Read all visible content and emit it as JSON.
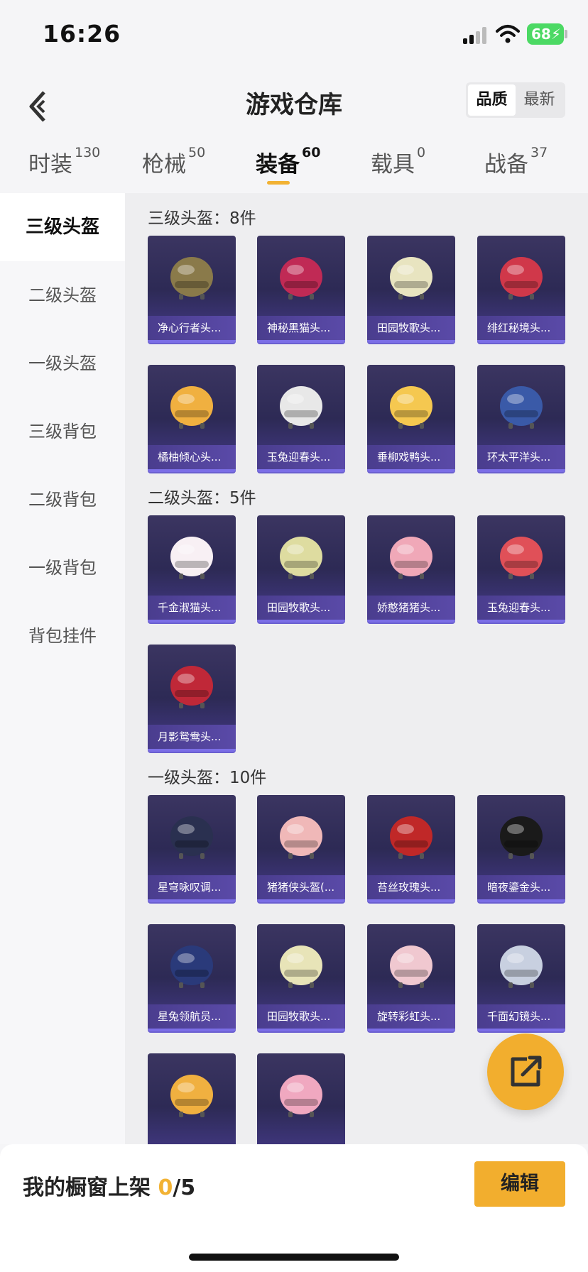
{
  "status_bar": {
    "time": "16:26",
    "battery": "68"
  },
  "nav": {
    "title": "游戏仓库",
    "sort_options": [
      "品质",
      "最新"
    ],
    "sort_selected": "品质"
  },
  "tabs": [
    {
      "label": "时装",
      "count": "130"
    },
    {
      "label": "枪械",
      "count": "50"
    },
    {
      "label": "装备",
      "count": "60"
    },
    {
      "label": "载具",
      "count": "0"
    },
    {
      "label": "战备",
      "count": "37"
    }
  ],
  "active_tab": "装备",
  "sidebar": {
    "items": [
      "三级头盔",
      "二级头盔",
      "一级头盔",
      "三级背包",
      "二级背包",
      "一级背包",
      "背包挂件"
    ],
    "active": "三级头盔"
  },
  "sections": [
    {
      "title": "三级头盔：8件",
      "items": [
        "净心行者头...",
        "神秘黑猫头...",
        "田园牧歌头...",
        "绯红秘境头...",
        "橘柚倾心头...",
        "玉兔迎春头...",
        "垂柳戏鸭头...",
        "环太平洋头..."
      ]
    },
    {
      "title": "二级头盔：5件",
      "items": [
        "千金淑猫头...",
        "田园牧歌头...",
        "娇憨猪猪头...",
        "玉兔迎春头...",
        "月影鸳鸯头..."
      ]
    },
    {
      "title": "一级头盔：10件",
      "items": [
        "星穹咏叹调...",
        "猪猪侠头盔(...",
        "苔丝玫瑰头...",
        "暗夜鎏金头...",
        "星兔领航员...",
        "田园牧歌头...",
        "旋转彩虹头...",
        "千面幻镜头...",
        "",
        ""
      ]
    }
  ],
  "helmet_colors": [
    "#8a7a4a",
    "#c02a55",
    "#e8e4c0",
    "#d0384a",
    "#f0b040",
    "#e8e8e8",
    "#f5c850",
    "#3a5aa8",
    "#f8f0f4",
    "#dedca0",
    "#f0a8b8",
    "#e05058",
    "#c02838",
    "#2a3050",
    "#f0b8b8",
    "#c02828",
    "#1a1a1a",
    "#2a3a7a",
    "#e8e4b8",
    "#f0c8d0",
    "#c8d0e0",
    "#f0b040",
    "#f0a8c0"
  ],
  "bottom": {
    "shelf_label": "我的橱窗上架 ",
    "shelf_count": "0",
    "shelf_total": "/5",
    "edit_label": "编辑"
  }
}
